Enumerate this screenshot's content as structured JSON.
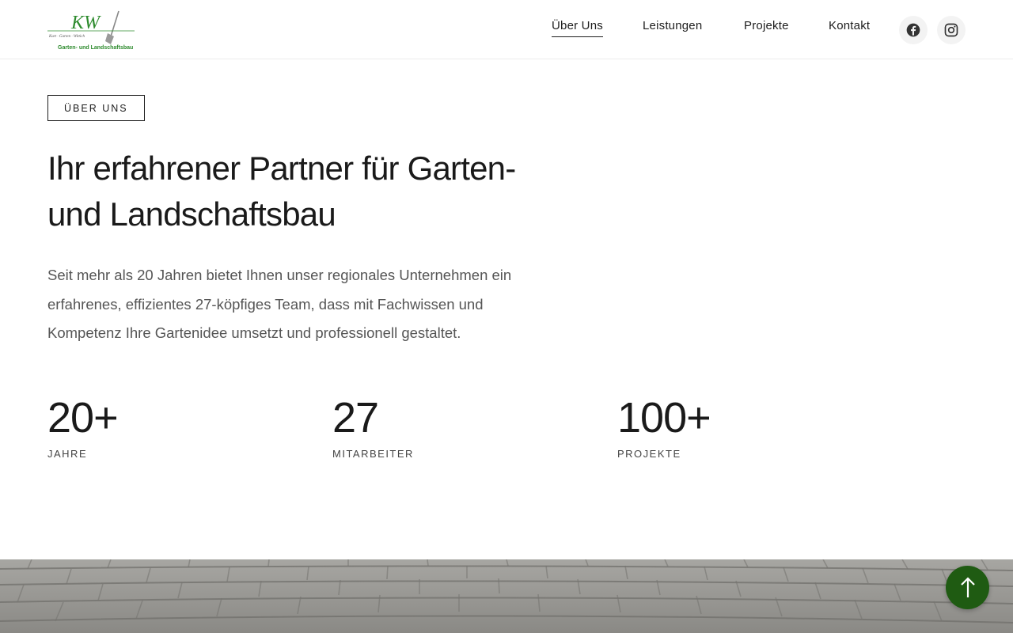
{
  "header": {
    "logo": {
      "initials": "KW",
      "owner_line": "Kurt · Garten · Wittich",
      "tagline": "Garten- und Landschaftsbau",
      "icon": "shovel-icon"
    },
    "nav": [
      {
        "label": "Über Uns",
        "active": true
      },
      {
        "label": "Leistungen",
        "active": false
      },
      {
        "label": "Projekte",
        "active": false
      },
      {
        "label": "Kontakt",
        "active": false
      }
    ],
    "social": [
      {
        "icon": "facebook-icon"
      },
      {
        "icon": "instagram-icon"
      }
    ]
  },
  "about": {
    "badge": "ÜBER UNS",
    "title": "Ihr erfahrener Partner für Garten- und Landschaftsbau",
    "intro": "Seit mehr als 20 Jahren bietet Ihnen unser regionales Unternehmen ein erfahrenes, effizientes 27-köpfiges Team, dass mit Fachwissen und Kompetenz Ihre Gartenidee umsetzt und professionell gestaltet.",
    "stats": [
      {
        "value": "20+",
        "label": "JAHRE"
      },
      {
        "value": "27",
        "label": "MITARBEITER"
      },
      {
        "value": "100+",
        "label": "PROJEKTE"
      }
    ]
  },
  "back_to_top": {
    "icon": "arrow-up-icon"
  },
  "colors": {
    "accent_green": "#1f5b12",
    "logo_green": "#2e8b2e",
    "text": "#1d1d1d",
    "muted_text": "#555555"
  }
}
